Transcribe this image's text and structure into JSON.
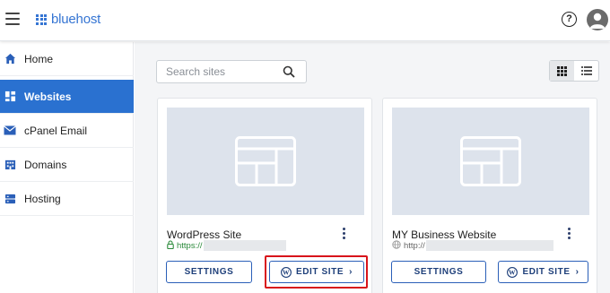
{
  "header": {
    "logo_text": "bluehost",
    "help_symbol": "?",
    "icons": {
      "menu": "hamburger-menu-icon",
      "help": "help-circle-icon",
      "avatar": "user-avatar-icon"
    }
  },
  "sidebar": {
    "items": [
      {
        "label": "Home",
        "icon": "home-icon",
        "active": false
      },
      {
        "label": "Websites",
        "icon": "websites-dashboard-icon",
        "active": true
      },
      {
        "label": "cPanel Email",
        "icon": "email-envelope-icon",
        "active": false
      },
      {
        "label": "Domains",
        "icon": "domains-building-icon",
        "active": false
      },
      {
        "label": "Hosting",
        "icon": "hosting-server-icon",
        "active": false
      }
    ]
  },
  "main": {
    "search": {
      "placeholder": "Search sites",
      "value": ""
    },
    "view_toggle": {
      "active": "grid",
      "options": [
        "grid",
        "list"
      ]
    },
    "sites": [
      {
        "name": "WordPress Site",
        "url_prefix": "https://",
        "secure": true,
        "settings_label": "SETTINGS",
        "edit_label": "EDIT SITE",
        "edit_highlighted": true
      },
      {
        "name": "MY Business Website",
        "url_prefix": "http://",
        "secure": false,
        "settings_label": "SETTINGS",
        "edit_label": "EDIT SITE",
        "edit_highlighted": false
      }
    ]
  },
  "colors": {
    "brand": "#3575d3",
    "active_nav": "#2a71d0",
    "button_border": "#2a5fb8",
    "button_text": "#1e3f7a",
    "secure_green": "#2a8a3a",
    "highlight_red": "#d8141b",
    "thumb_bg": "#dde3ec"
  }
}
